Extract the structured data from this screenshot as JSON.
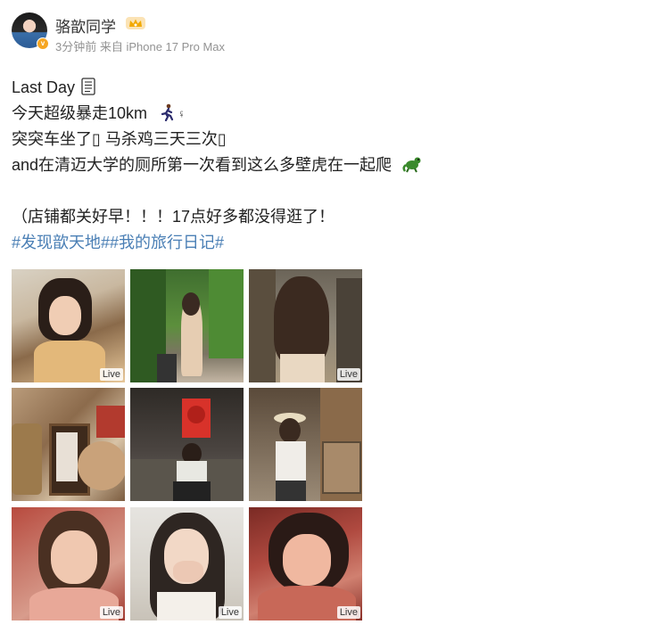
{
  "post": {
    "username": "骆歆同学",
    "meta": "3分钟前 来自 iPhone 17 Pro Max",
    "lines": [
      "Last Day",
      "今天超级暴走10km",
      "突突车坐了▯ 马杀鸡三天三次▯",
      "and在清迈大学的厕所第一次看到这么多壁虎在一起爬",
      "（店铺都关好早！！！17点好多都没得逛了！"
    ],
    "hashtags": "#发现歆天地##我的旅行日记#"
  },
  "photos": [
    {
      "id": "photo-1",
      "live": "Live"
    },
    {
      "id": "photo-2",
      "live": ""
    },
    {
      "id": "photo-3",
      "live": "Live"
    },
    {
      "id": "photo-4",
      "live": ""
    },
    {
      "id": "photo-5",
      "live": ""
    },
    {
      "id": "photo-6",
      "live": ""
    },
    {
      "id": "photo-7",
      "live": "Live"
    },
    {
      "id": "photo-8",
      "live": "Live"
    },
    {
      "id": "photo-9",
      "live": "Live"
    }
  ],
  "icons": {
    "crown": "crown-icon",
    "verified": "verified-badge-icon",
    "book": "book-icon",
    "runner": "runner-icon",
    "lizard": "lizard-icon"
  }
}
